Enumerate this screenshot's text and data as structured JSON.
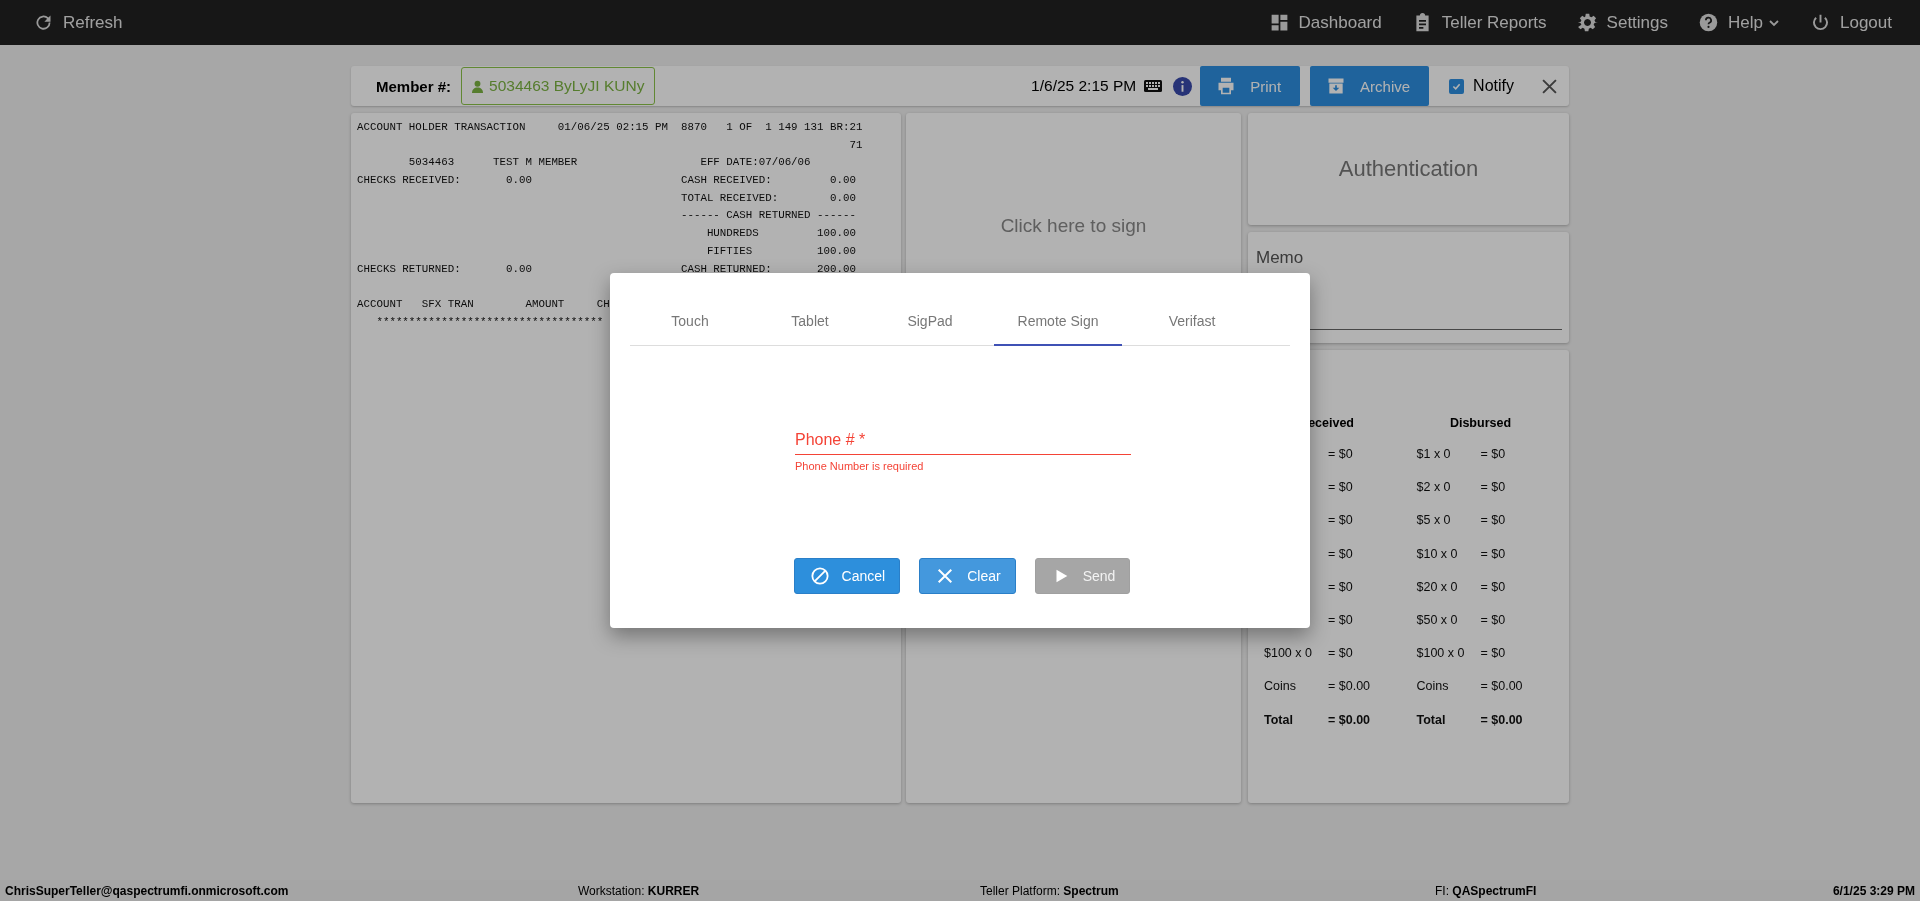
{
  "top_bar": {
    "refresh": "Refresh",
    "nav": [
      {
        "kind": "dashboard",
        "label": "Dashboard"
      },
      {
        "kind": "reports",
        "label": "Teller Reports"
      },
      {
        "kind": "settings",
        "label": "Settings"
      },
      {
        "kind": "help",
        "label": "Help"
      },
      {
        "kind": "logout",
        "label": "Logout"
      }
    ]
  },
  "member_bar": {
    "label": "Member #:",
    "member": "5034463 ByLyJI KUNy",
    "datetime": "1/6/25 2:15 PM",
    "buttons": [
      {
        "kind": "print",
        "label": "Print"
      },
      {
        "kind": "archive",
        "label": "Archive"
      }
    ],
    "notify": {
      "label": "Notify",
      "checked": true
    }
  },
  "receipt": {
    "summary": [
      "ACCOUNT HOLDER TRANSACTION     01/06/25 02:15 PM  8870   1 OF  1 149 131 BR:21",
      "                                                                            71",
      "        5034463      TEST M MEMBER                   EFF DATE:07/06/06",
      "CHECKS RECEIVED:       0.00                       CASH RECEIVED:         0.00",
      "                                                  TOTAL RECEIVED:        0.00",
      "                                                  ------ CASH RETURNED ------",
      "                                                      HUNDREDS         100.00",
      "                                                      FIFTIES          100.00",
      "CHECKS RETURNED:       0.00                       CASH RETURNED:       200.00"
    ],
    "detail": [
      "ACCOUNT   SFX TRAN        AMOUNT     CH",
      "   ***********************************"
    ]
  },
  "signature": {
    "prompt": "Click here to sign"
  },
  "authentication": {
    "title": "Authentication"
  },
  "memo": {
    "label": "Memo"
  },
  "cash": {
    "received": {
      "header": "eceived",
      "rows": [
        {
          "kind": "count",
          "value": "= $0"
        },
        {
          "kind": "count",
          "value": "= $0"
        },
        {
          "kind": "count",
          "value": "= $0"
        },
        {
          "kind": "count",
          "value": "= $0"
        },
        {
          "kind": "count",
          "value": "= $0"
        },
        {
          "kind": "count",
          "value": "= $0"
        },
        {
          "kind": "count",
          "label": "$100 x 0",
          "value": "= $0"
        },
        {
          "kind": "count",
          "label": "Coins",
          "value": "= $0.00"
        },
        {
          "kind": "total",
          "label": "Total",
          "value": "= $0.00"
        }
      ]
    },
    "disbursed": {
      "header": "Disbursed",
      "rows": [
        {
          "kind": "count",
          "label": "$1 x 0",
          "value": "= $0"
        },
        {
          "kind": "count",
          "label": "$2 x 0",
          "value": "= $0"
        },
        {
          "kind": "count",
          "label": "$5 x 0",
          "value": "= $0"
        },
        {
          "kind": "count",
          "label": "$10 x 0",
          "value": "= $0"
        },
        {
          "kind": "count",
          "label": "$20 x 0",
          "value": "= $0"
        },
        {
          "kind": "count",
          "label": "$50 x 0",
          "value": "= $0"
        },
        {
          "kind": "count",
          "label": "$100 x 0",
          "value": "= $0"
        },
        {
          "kind": "count",
          "label": "Coins",
          "value": "= $0.00"
        },
        {
          "kind": "total",
          "label": "Total",
          "value": "= $0.00"
        }
      ]
    }
  },
  "dialog": {
    "tabs": [
      {
        "label": "Touch",
        "selected": false
      },
      {
        "label": "Tablet",
        "selected": false
      },
      {
        "label": "SigPad",
        "selected": false
      },
      {
        "label": "Remote Sign",
        "selected": true
      },
      {
        "label": "Verifast",
        "selected": false
      }
    ],
    "phone": {
      "label": "Phone # *",
      "error": "Phone Number is required",
      "invalid": true
    },
    "buttons": [
      {
        "kind": "cancel",
        "label": "Cancel",
        "disabled": false
      },
      {
        "kind": "clear",
        "label": "Clear",
        "disabled": false
      },
      {
        "kind": "send",
        "label": "Send",
        "disabled": true
      }
    ]
  },
  "status_bar": {
    "user": "ChrisSuperTeller@qaspectrumfi.onmicrosoft.com",
    "items": [
      "Workstation: **KURRER**",
      "Teller Platform: **Spectrum**",
      "FI: **QASpectrumFI**"
    ],
    "datetime": "6/1/25 3:29 PM"
  }
}
